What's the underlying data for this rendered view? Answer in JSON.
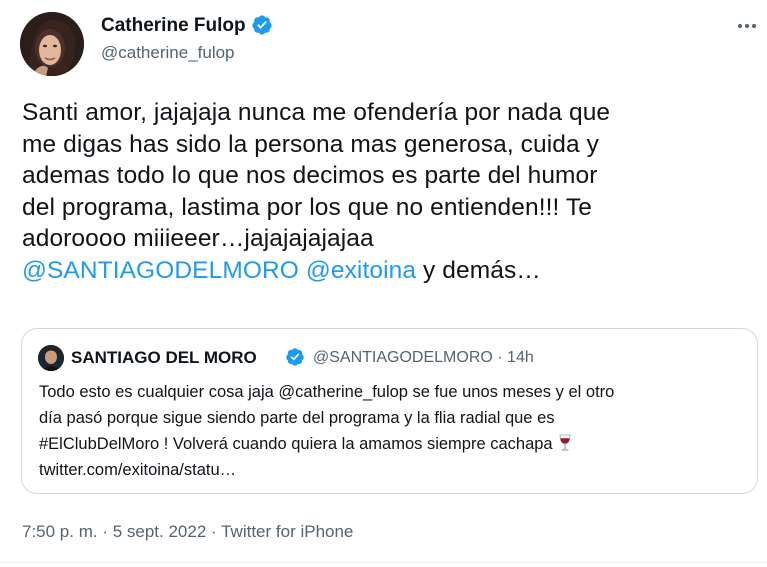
{
  "author": {
    "name": "Catherine Fulop",
    "handle": "@catherine_fulop",
    "verified": true
  },
  "tweet": {
    "lines": [
      "Santi amor, jajajaja nunca me ofendería por nada que",
      "me digas has sido la persona mas generosa, cuida y",
      "ademas todo lo que nos decimos es parte del humor",
      "del programa, lastima por los que no entienden!!! Te",
      "adoroooo miiieeer…jajajajajajaa"
    ],
    "mention_1": "@SANTIAGODELMORO",
    "mention_2": "@exitoina",
    "tail": " y demás…"
  },
  "quote": {
    "name": "SANTIAGO DEL MORO",
    "verified": true,
    "meta": "@SANTIAGODELMORO · 14h",
    "lines": [
      "Todo esto  es cualquier cosa jaja @catherine_fulop se fue unos meses y el otro",
      "día pasó porque sigue siendo parte del programa y la flia radial que es",
      "#ElClubDelMoro !  Volverá cuando quiera la amamos siempre cachapa",
      "twitter.com/exitoina/statu…"
    ],
    "emoji_icon": "wine-glass-icon"
  },
  "footer": {
    "time": "7:50 p. m.",
    "separator": " · ",
    "date": "5 sept. 2022",
    "source": "Twitter for iPhone"
  },
  "colors": {
    "text": "#0f1419",
    "secondary": "#536471",
    "link": "#1d9bf0",
    "verified": "#1d9bf0",
    "border": "#cfd9de"
  }
}
